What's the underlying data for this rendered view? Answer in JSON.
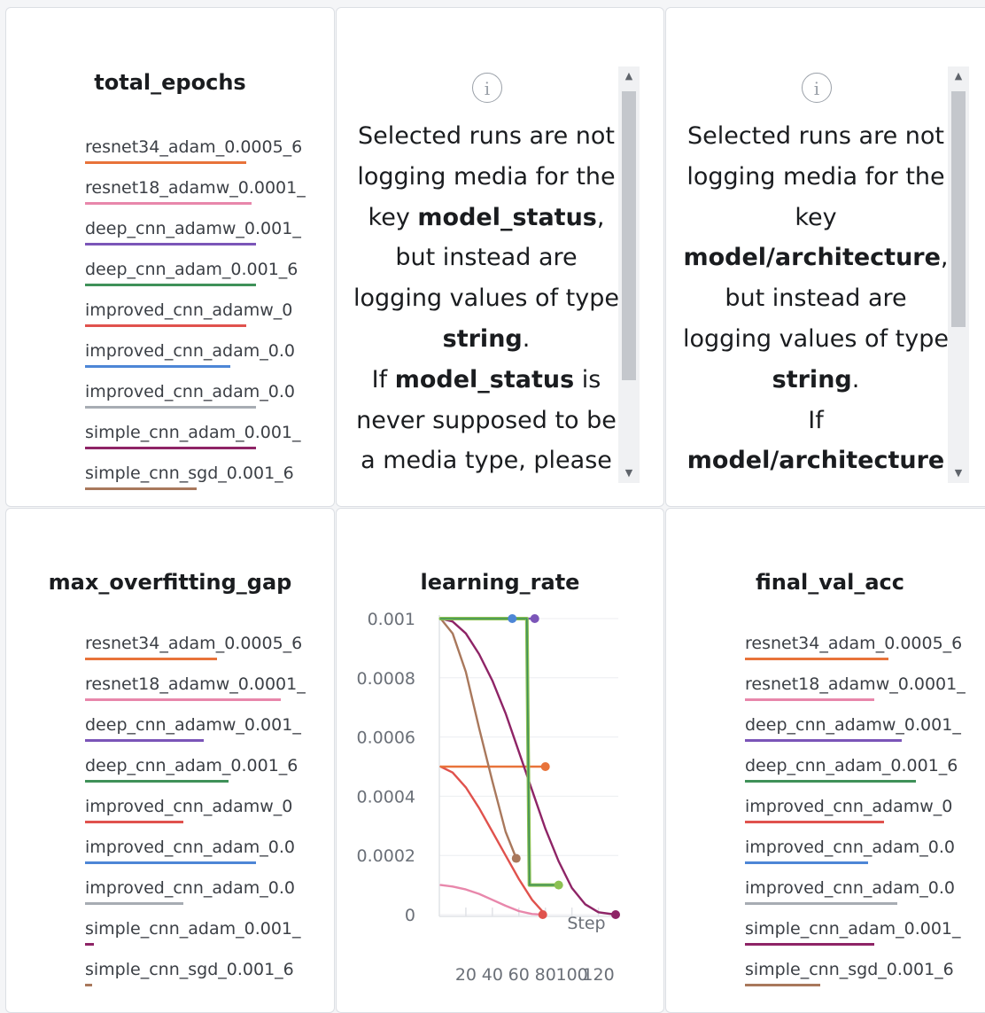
{
  "runs": [
    {
      "name": "resnet34_adam_0.0005_6",
      "color": "#e8733a"
    },
    {
      "name": "resnet18_adamw_0.0001_",
      "color": "#e887ab"
    },
    {
      "name": "deep_cnn_adamw_0.001_",
      "color": "#7b55b8"
    },
    {
      "name": "deep_cnn_adam_0.001_6",
      "color": "#3f9159"
    },
    {
      "name": "improved_cnn_adamw_0",
      "color": "#e0524d"
    },
    {
      "name": "improved_cnn_adam_0.0",
      "color": "#4d86d6"
    },
    {
      "name": "improved_cnn_adam_0.0",
      "color": "#a7acb3"
    },
    {
      "name": "simple_cnn_adam_0.001_",
      "color": "#8e2466"
    },
    {
      "name": "simple_cnn_sgd_0.001_6",
      "color": "#a9785c"
    }
  ],
  "panels": {
    "total_epochs": {
      "title": "total_epochs",
      "bar_fractions": [
        0.71,
        0.73,
        0.75,
        0.75,
        0.71,
        0.64,
        0.75,
        0.75,
        0.49
      ]
    },
    "model_status": {
      "msg_part1": "Selected runs are not logging media for the key ",
      "key": "model_status",
      "msg_part2": ", but instead are logging values of type ",
      "type": "string",
      "msg_part3": ".",
      "msg_part4": "If ",
      "msg_part5": " is never supposed to be a media type, please"
    },
    "model_architecture": {
      "msg_part1": "Selected runs are not logging media for the key ",
      "key": "model/architecture",
      "msg_part2": ", but instead are logging values of type ",
      "type": "string",
      "msg_part3": ".",
      "msg_part4": "If "
    },
    "max_overfitting_gap": {
      "title": "max_overfitting_gap",
      "bar_fractions": [
        0.58,
        0.86,
        0.52,
        0.63,
        0.43,
        0.75,
        0.43,
        0.04,
        0.03
      ]
    },
    "learning_rate": {
      "title": "learning_rate"
    },
    "final_val_acc": {
      "title": "final_val_acc",
      "bar_fractions": [
        0.63,
        0.57,
        0.69,
        0.75,
        0.61,
        0.54,
        0.67,
        0.57,
        0.33
      ]
    }
  },
  "chart_data": {
    "type": "line",
    "title": "learning_rate",
    "xlabel": "Step",
    "ylabel": "",
    "xlim": [
      0,
      135
    ],
    "ylim": [
      0,
      0.001
    ],
    "x_ticks": [
      20,
      40,
      60,
      80,
      100,
      120
    ],
    "y_ticks": [
      0,
      0.0002,
      0.0004,
      0.0006,
      0.0008,
      0.001
    ],
    "y_tick_labels": [
      "0",
      "0.0002",
      "0.0004",
      "0.0006",
      "0.0008",
      "0.001"
    ],
    "grid": true,
    "series": [
      {
        "color": "#e887ab",
        "points": [
          [
            1,
            0.0001
          ],
          [
            10,
            9.5e-05
          ],
          [
            20,
            8.5e-05
          ],
          [
            30,
            7e-05
          ],
          [
            40,
            5e-05
          ],
          [
            50,
            3e-05
          ],
          [
            60,
            1.2e-05
          ],
          [
            70,
            2e-06
          ],
          [
            78,
            0
          ]
        ]
      },
      {
        "color": "#e0524d",
        "points": [
          [
            1,
            0.0005
          ],
          [
            10,
            0.00048
          ],
          [
            20,
            0.00043
          ],
          [
            30,
            0.00036
          ],
          [
            40,
            0.00028
          ],
          [
            50,
            0.0002
          ],
          [
            60,
            0.00012
          ],
          [
            70,
            5e-05
          ],
          [
            78,
            1e-05
          ],
          [
            80,
            0
          ]
        ]
      },
      {
        "color": "#e8733a",
        "points": [
          [
            1,
            0.0005
          ],
          [
            80,
            0.0005
          ]
        ]
      },
      {
        "color": "#a9785c",
        "points": [
          [
            1,
            0.001
          ],
          [
            10,
            0.00095
          ],
          [
            20,
            0.00082
          ],
          [
            30,
            0.00063
          ],
          [
            40,
            0.00045
          ],
          [
            50,
            0.00028
          ],
          [
            58,
            0.00019
          ]
        ]
      },
      {
        "color": "#8e2466",
        "points": [
          [
            1,
            0.001
          ],
          [
            10,
            0.00099
          ],
          [
            20,
            0.00095
          ],
          [
            30,
            0.00088
          ],
          [
            40,
            0.00079
          ],
          [
            50,
            0.00068
          ],
          [
            60,
            0.00055
          ],
          [
            70,
            0.00042
          ],
          [
            80,
            0.00029
          ],
          [
            90,
            0.00018
          ],
          [
            100,
            9e-05
          ],
          [
            110,
            3.5e-05
          ],
          [
            120,
            8e-06
          ],
          [
            133,
            0
          ]
        ]
      },
      {
        "color": "#7b55b8",
        "points": [
          [
            1,
            0.001
          ],
          [
            72,
            0.001
          ]
        ]
      },
      {
        "color": "#4d86d6",
        "points": [
          [
            1,
            0.001
          ],
          [
            55,
            0.001
          ]
        ]
      },
      {
        "color": "#a7acb3",
        "points": [
          [
            1,
            0.001
          ],
          [
            55,
            0.001
          ]
        ]
      },
      {
        "color": "#8cc152",
        "width": 4,
        "points": [
          [
            1,
            0.001
          ],
          [
            66,
            0.001
          ],
          [
            68,
            0.0001
          ],
          [
            90,
            0.0001
          ]
        ]
      },
      {
        "color": "#3f9159",
        "width": 1.6,
        "points": [
          [
            1,
            0.001
          ],
          [
            66,
            0.001
          ],
          [
            68,
            0.0001
          ],
          [
            90,
            0.0001
          ]
        ]
      }
    ],
    "end_markers": [
      {
        "x": 55,
        "y": 0.001,
        "color": "#4d86d6"
      },
      {
        "x": 72,
        "y": 0.001,
        "color": "#7b55b8"
      },
      {
        "x": 80,
        "y": 0.0005,
        "color": "#e8733a"
      },
      {
        "x": 58,
        "y": 0.00019,
        "color": "#a9785c"
      },
      {
        "x": 90,
        "y": 0.0001,
        "color": "#8cc152"
      },
      {
        "x": 78,
        "y": 0,
        "color": "#e0524d"
      },
      {
        "x": 133,
        "y": 0,
        "color": "#8e2466"
      }
    ]
  }
}
